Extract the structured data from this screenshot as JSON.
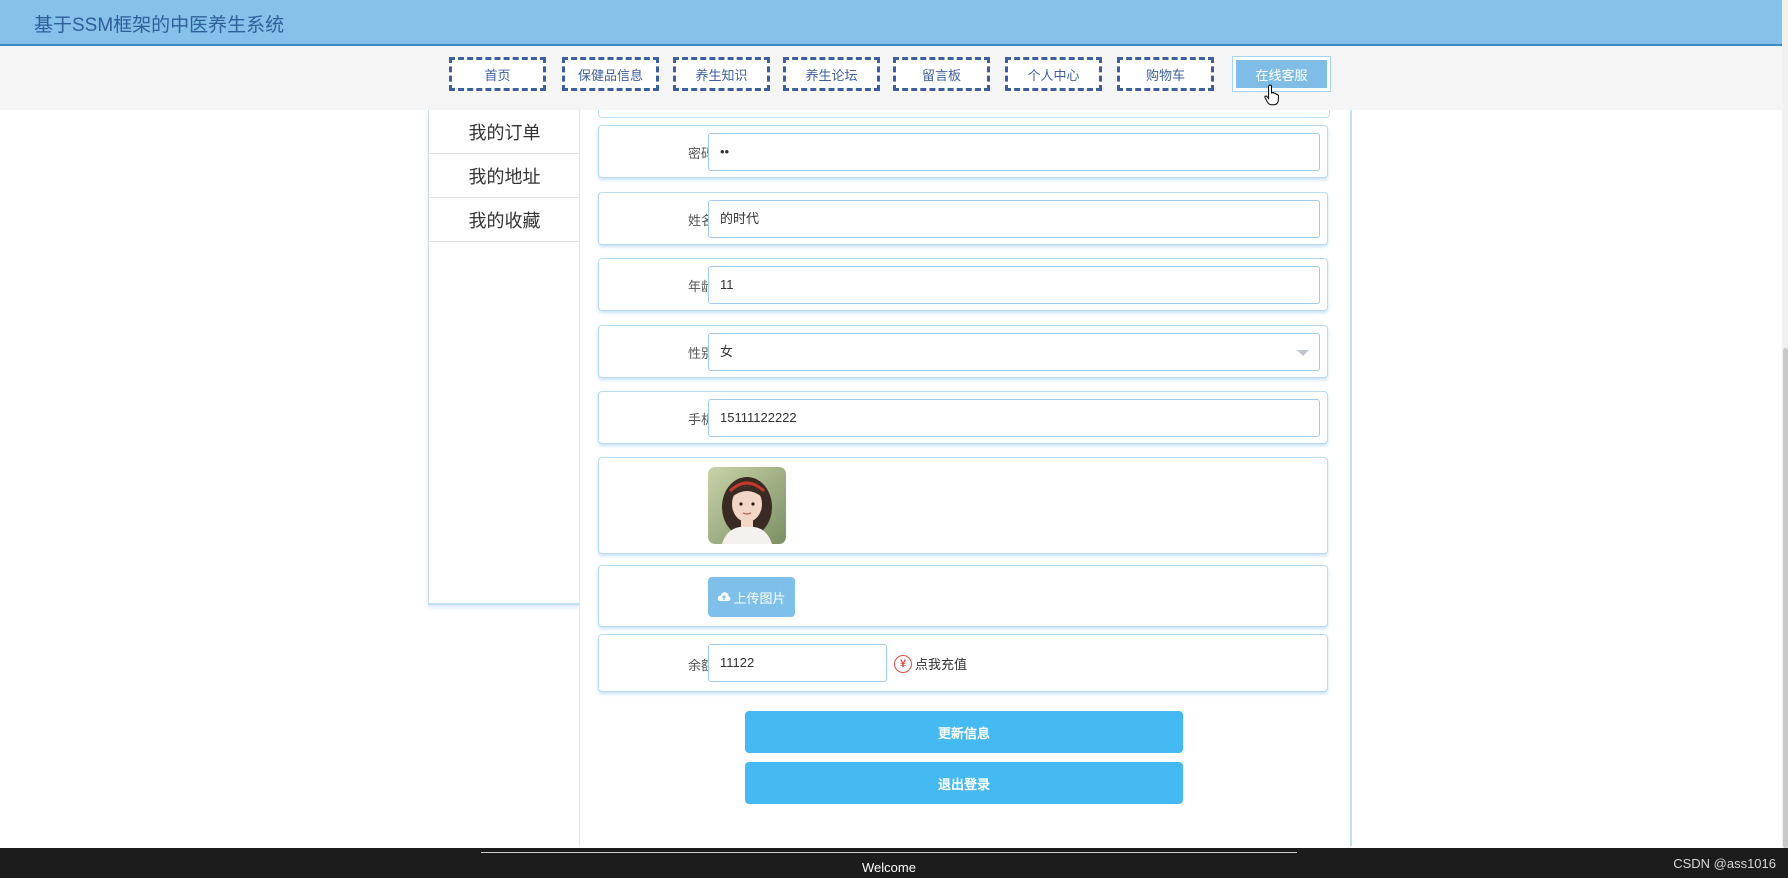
{
  "header": {
    "title": "基于SSM框架的中医养生系统"
  },
  "nav": {
    "items": [
      {
        "label": "首页"
      },
      {
        "label": "保健品信息"
      },
      {
        "label": "养生知识"
      },
      {
        "label": "养生论坛"
      },
      {
        "label": "留言板"
      },
      {
        "label": "个人中心"
      },
      {
        "label": "购物车"
      },
      {
        "label": "在线客服"
      }
    ],
    "active": "在线客服"
  },
  "sidebar": {
    "items": [
      {
        "label": "我的订单"
      },
      {
        "label": "我的地址"
      },
      {
        "label": "我的收藏"
      }
    ]
  },
  "form": {
    "password": {
      "label": "密码",
      "value": "••"
    },
    "name": {
      "label": "姓名",
      "value": "的时代"
    },
    "age": {
      "label": "年龄",
      "value": "11"
    },
    "gender": {
      "label": "性别",
      "value": "女"
    },
    "phone": {
      "label": "手机",
      "value": "15111122222"
    },
    "upload_label": "上传图片",
    "balance": {
      "label": "余额",
      "value": "11122"
    },
    "recharge_label": "点我充值",
    "update_button": "更新信息",
    "logout_button": "退出登录"
  },
  "footer": {
    "welcome": "Welcome",
    "credit": "CSDN @ass1016"
  },
  "colors": {
    "header_bg": "#85c1e9",
    "nav_border": "#3d5f9e",
    "active_tab": "#7fbde7",
    "primary_button": "#44b9f2",
    "recharge_icon": "#e34a4a",
    "footer_bg": "#1c1c1c"
  },
  "icons": [
    "hand-pointer-icon",
    "cloud-upload-icon",
    "yen-icon",
    "chevron-down-icon"
  ]
}
